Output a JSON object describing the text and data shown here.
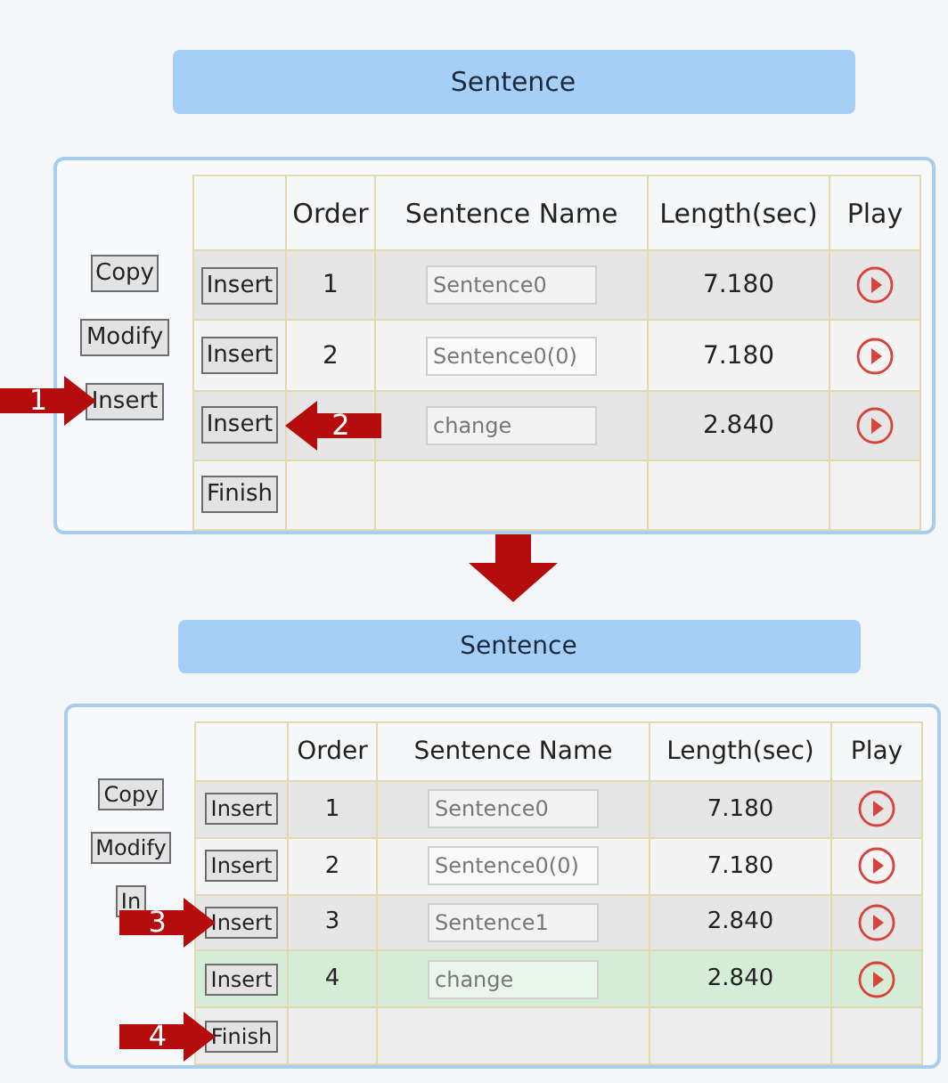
{
  "panels": [
    {
      "title": "Sentence",
      "side_buttons": [
        {
          "label": "Copy"
        },
        {
          "label": "Modify"
        },
        {
          "label": "Insert",
          "callout": {
            "number": "1",
            "kind": "right"
          }
        }
      ],
      "table": {
        "columns": [
          "Order",
          "Sentence Name",
          "Length(sec)",
          "Play"
        ],
        "rows": [
          {
            "insert": {
              "label": "Insert"
            },
            "order": "1",
            "name": "Sentence0",
            "length": "7.180",
            "highlighted": false
          },
          {
            "insert": {
              "label": "Insert"
            },
            "order": "2",
            "name": "Sentence0(0)",
            "length": "7.180",
            "highlighted": false
          },
          {
            "insert": {
              "label": "Insert",
              "callout": {
                "number": "2",
                "kind": "left"
              }
            },
            "order": "",
            "name": "change",
            "length": "2.840",
            "highlighted": false
          }
        ],
        "finish": {
          "label": "Finish"
        }
      }
    },
    {
      "title": "Sentence",
      "side_buttons": [
        {
          "label": "Copy"
        },
        {
          "label": "Modify"
        },
        {
          "label": "In"
        }
      ],
      "table": {
        "columns": [
          "Order",
          "Sentence Name",
          "Length(sec)",
          "Play"
        ],
        "rows": [
          {
            "insert": {
              "label": "Insert"
            },
            "order": "1",
            "name": "Sentence0",
            "length": "7.180",
            "highlighted": false
          },
          {
            "insert": {
              "label": "Insert"
            },
            "order": "2",
            "name": "Sentence0(0)",
            "length": "7.180",
            "highlighted": false
          },
          {
            "insert": {
              "label": "Insert",
              "callout": {
                "number": "3",
                "kind": "right"
              }
            },
            "order": "3",
            "name": "Sentence1",
            "length": "2.840",
            "highlighted": false
          },
          {
            "insert": {
              "label": "Insert"
            },
            "order": "4",
            "name": "change",
            "length": "2.840",
            "highlighted": true
          }
        ],
        "finish": {
          "label": "Finish",
          "callout": {
            "number": "4",
            "kind": "right"
          }
        }
      }
    }
  ]
}
